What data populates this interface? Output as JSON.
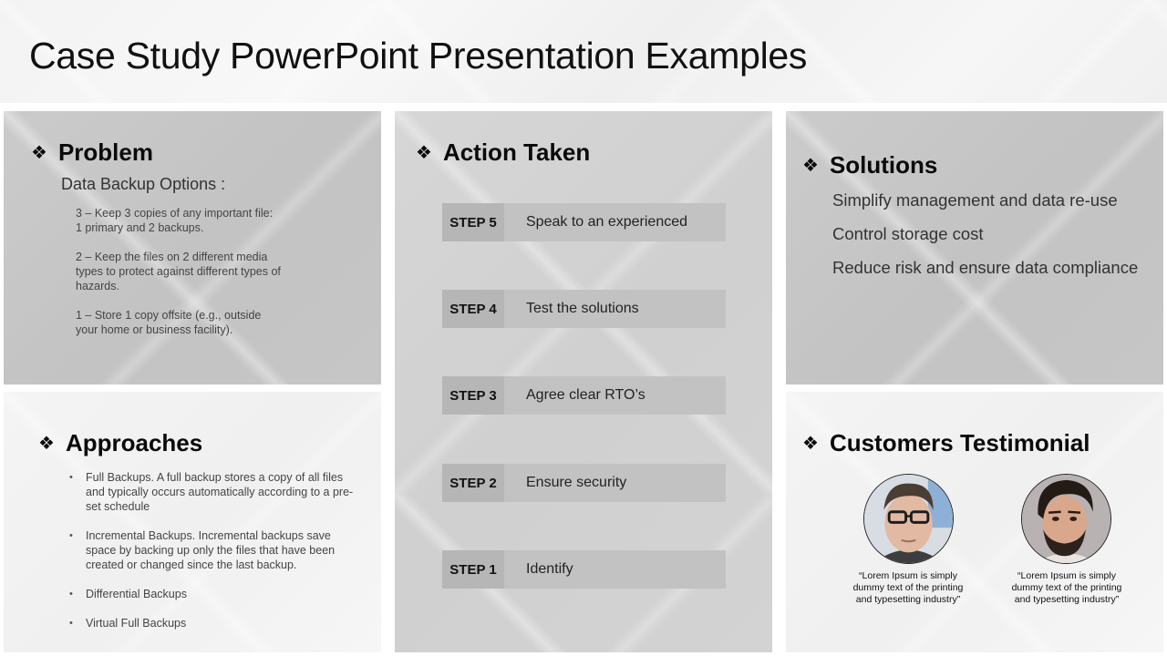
{
  "title": "Case Study PowerPoint Presentation Examples",
  "section_icon": "❖",
  "problem": {
    "heading": "Problem",
    "subheading": "Data Backup Options :",
    "items": [
      "3 – Keep 3 copies of any important  file:\n      1 primary  and  2 backups.",
      "2 – Keep the files on 2 different media types to protect against different types of hazards.",
      "1 – Store 1 copy offsite (e.g., outside your home or business facility)."
    ]
  },
  "approaches": {
    "heading": "Approaches",
    "items": [
      "Full Backups. A full backup stores a copy of all files and typically occurs automatically  according to a pre-set schedule",
      "Incremental Backups. Incremental backups save space by backing up only the files that have been created or changed  since the last backup.",
      "Differential Backups",
      "Virtual  Full Backups"
    ]
  },
  "action": {
    "heading": "Action Taken",
    "steps": [
      {
        "label": "STEP 5",
        "text": "Speak to an experienced"
      },
      {
        "label": "STEP 4",
        "text": "Test the solutions"
      },
      {
        "label": "STEP 3",
        "text": "Agree clear RTO’s"
      },
      {
        "label": "STEP 2",
        "text": "Ensure security"
      },
      {
        "label": "STEP 1",
        "text": "Identify"
      }
    ]
  },
  "solutions": {
    "heading": "Solutions",
    "items": [
      "Simplify management and data re-use",
      "Control storage cost",
      "Reduce risk and ensure data compliance"
    ]
  },
  "testimonial": {
    "heading": "Customers Testimonial",
    "customers": [
      {
        "avatar": "man-with-glasses-photo",
        "quote": "“Lorem Ipsum is simply dummy text of the printing and typesetting industry”"
      },
      {
        "avatar": "bearded-man-photo",
        "quote": "“Lorem Ipsum is simply dummy text of the printing and typesetting industry”"
      }
    ]
  }
}
